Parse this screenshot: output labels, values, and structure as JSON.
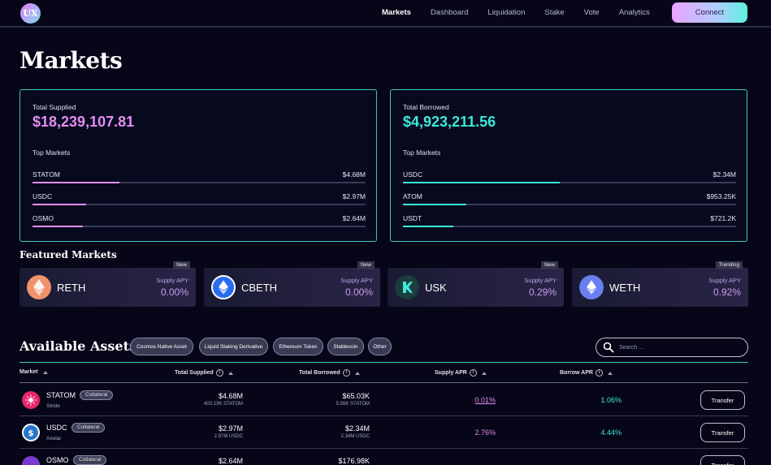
{
  "nav": {
    "logo_text": "UX",
    "links": [
      "Markets",
      "Dashboard",
      "Liquidation",
      "Stake",
      "Vote",
      "Analytics"
    ],
    "active": "Markets",
    "connect_label": "Connect"
  },
  "page_title": "Markets",
  "supplied": {
    "label": "Total Supplied",
    "value": "$18,239,107.81",
    "top_label": "Top Markets",
    "markets": [
      {
        "name": "STATOM",
        "value": "$4.68M",
        "share": 0.26
      },
      {
        "name": "USDC",
        "value": "$2.97M",
        "share": 0.16
      },
      {
        "name": "OSMO",
        "value": "$2.64M",
        "share": 0.15
      }
    ]
  },
  "borrowed": {
    "label": "Total Borrowed",
    "value": "$4,923,211.56",
    "top_label": "Top Markets",
    "markets": [
      {
        "name": "USDC",
        "value": "$2.34M",
        "share": 0.47
      },
      {
        "name": "ATOM",
        "value": "$953.25K",
        "share": 0.19
      },
      {
        "name": "USDT",
        "value": "$721.2K",
        "share": 0.15
      }
    ]
  },
  "featured": {
    "title": "Featured Markets",
    "cards": [
      {
        "name": "RETH",
        "apy_label": "Supply APY",
        "apy": "0.00%",
        "tag": "New",
        "icon": "reth-icon",
        "color": "#f0936b"
      },
      {
        "name": "CBETH",
        "apy_label": "Supply APY",
        "apy": "0.00%",
        "tag": "New",
        "icon": "cbeth-icon",
        "color": "#2a6cf0"
      },
      {
        "name": "USK",
        "apy_label": "Supply APY",
        "apy": "0.29%",
        "tag": "New",
        "icon": "usk-icon",
        "color": "#1c3c3e"
      },
      {
        "name": "WETH",
        "apy_label": "Supply APY",
        "apy": "0.92%",
        "tag": "Trending",
        "icon": "weth-icon",
        "color": "#6a7ef0"
      }
    ]
  },
  "assets": {
    "title": "Available Assets",
    "filters": [
      "Cosmos Native Asset",
      "Liquid Staking Derivative",
      "Ethereum Token",
      "Stablecoin",
      "Other"
    ],
    "search_placeholder": "Search ...",
    "columns": {
      "market": "Market",
      "supplied": "Total Supplied",
      "borrowed": "Total Borrowed",
      "supply_apr": "Supply APR",
      "borrow_apr": "Borrow APR"
    },
    "rows": [
      {
        "symbol": "STATOM",
        "badge": "Collateral",
        "chain": "Stride",
        "supplied": "$4.68M",
        "supplied_sub": "400.13K STATOM",
        "borrowed": "$65.03K",
        "borrowed_sub": "5.56K STATOM",
        "supply_apr": "0.01%",
        "borrow_apr": "1.06%",
        "transfer": "Transfer",
        "icon": "statom-icon"
      },
      {
        "symbol": "USDC",
        "badge": "Collateral",
        "chain": "Axelar",
        "supplied": "$2.97M",
        "supplied_sub": "2.97M USDC",
        "borrowed": "$2.34M",
        "borrowed_sub": "2.34M USDC",
        "supply_apr": "2.76%",
        "borrow_apr": "4.44%",
        "transfer": "Transfer",
        "icon": "usdc-icon"
      },
      {
        "symbol": "OSMO",
        "badge": "Collateral",
        "chain": "",
        "supplied": "$2.64M",
        "supplied_sub": "",
        "borrowed": "$176.98K",
        "borrowed_sub": "",
        "supply_apr": "",
        "borrow_apr": "",
        "transfer": "Transfer",
        "icon": "osmo-icon"
      }
    ]
  },
  "colors": {
    "supply": "#e58cf2",
    "borrow": "#3ee8d8",
    "accent_border": "#3cc9c0"
  }
}
